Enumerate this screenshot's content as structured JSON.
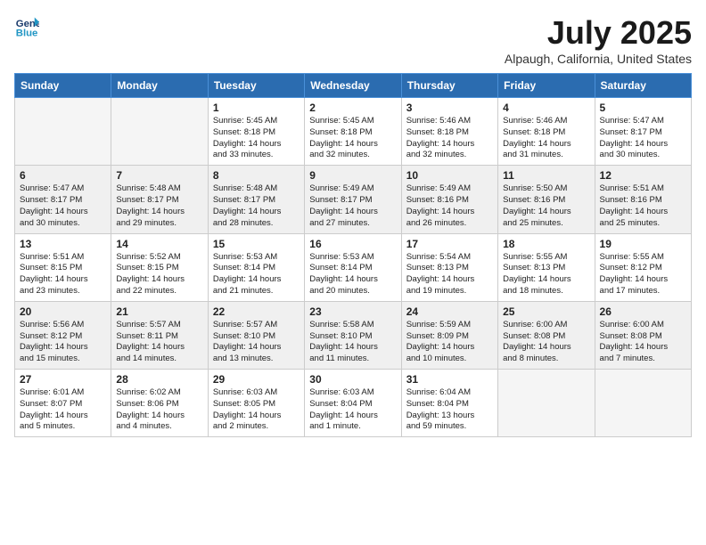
{
  "header": {
    "logo_line1": "General",
    "logo_line2": "Blue",
    "month": "July 2025",
    "location": "Alpaugh, California, United States"
  },
  "weekdays": [
    "Sunday",
    "Monday",
    "Tuesday",
    "Wednesday",
    "Thursday",
    "Friday",
    "Saturday"
  ],
  "weeks": [
    [
      {
        "day": "",
        "info": ""
      },
      {
        "day": "",
        "info": ""
      },
      {
        "day": "1",
        "info": "Sunrise: 5:45 AM\nSunset: 8:18 PM\nDaylight: 14 hours\nand 33 minutes."
      },
      {
        "day": "2",
        "info": "Sunrise: 5:45 AM\nSunset: 8:18 PM\nDaylight: 14 hours\nand 32 minutes."
      },
      {
        "day": "3",
        "info": "Sunrise: 5:46 AM\nSunset: 8:18 PM\nDaylight: 14 hours\nand 32 minutes."
      },
      {
        "day": "4",
        "info": "Sunrise: 5:46 AM\nSunset: 8:18 PM\nDaylight: 14 hours\nand 31 minutes."
      },
      {
        "day": "5",
        "info": "Sunrise: 5:47 AM\nSunset: 8:17 PM\nDaylight: 14 hours\nand 30 minutes."
      }
    ],
    [
      {
        "day": "6",
        "info": "Sunrise: 5:47 AM\nSunset: 8:17 PM\nDaylight: 14 hours\nand 30 minutes."
      },
      {
        "day": "7",
        "info": "Sunrise: 5:48 AM\nSunset: 8:17 PM\nDaylight: 14 hours\nand 29 minutes."
      },
      {
        "day": "8",
        "info": "Sunrise: 5:48 AM\nSunset: 8:17 PM\nDaylight: 14 hours\nand 28 minutes."
      },
      {
        "day": "9",
        "info": "Sunrise: 5:49 AM\nSunset: 8:17 PM\nDaylight: 14 hours\nand 27 minutes."
      },
      {
        "day": "10",
        "info": "Sunrise: 5:49 AM\nSunset: 8:16 PM\nDaylight: 14 hours\nand 26 minutes."
      },
      {
        "day": "11",
        "info": "Sunrise: 5:50 AM\nSunset: 8:16 PM\nDaylight: 14 hours\nand 25 minutes."
      },
      {
        "day": "12",
        "info": "Sunrise: 5:51 AM\nSunset: 8:16 PM\nDaylight: 14 hours\nand 25 minutes."
      }
    ],
    [
      {
        "day": "13",
        "info": "Sunrise: 5:51 AM\nSunset: 8:15 PM\nDaylight: 14 hours\nand 23 minutes."
      },
      {
        "day": "14",
        "info": "Sunrise: 5:52 AM\nSunset: 8:15 PM\nDaylight: 14 hours\nand 22 minutes."
      },
      {
        "day": "15",
        "info": "Sunrise: 5:53 AM\nSunset: 8:14 PM\nDaylight: 14 hours\nand 21 minutes."
      },
      {
        "day": "16",
        "info": "Sunrise: 5:53 AM\nSunset: 8:14 PM\nDaylight: 14 hours\nand 20 minutes."
      },
      {
        "day": "17",
        "info": "Sunrise: 5:54 AM\nSunset: 8:13 PM\nDaylight: 14 hours\nand 19 minutes."
      },
      {
        "day": "18",
        "info": "Sunrise: 5:55 AM\nSunset: 8:13 PM\nDaylight: 14 hours\nand 18 minutes."
      },
      {
        "day": "19",
        "info": "Sunrise: 5:55 AM\nSunset: 8:12 PM\nDaylight: 14 hours\nand 17 minutes."
      }
    ],
    [
      {
        "day": "20",
        "info": "Sunrise: 5:56 AM\nSunset: 8:12 PM\nDaylight: 14 hours\nand 15 minutes."
      },
      {
        "day": "21",
        "info": "Sunrise: 5:57 AM\nSunset: 8:11 PM\nDaylight: 14 hours\nand 14 minutes."
      },
      {
        "day": "22",
        "info": "Sunrise: 5:57 AM\nSunset: 8:10 PM\nDaylight: 14 hours\nand 13 minutes."
      },
      {
        "day": "23",
        "info": "Sunrise: 5:58 AM\nSunset: 8:10 PM\nDaylight: 14 hours\nand 11 minutes."
      },
      {
        "day": "24",
        "info": "Sunrise: 5:59 AM\nSunset: 8:09 PM\nDaylight: 14 hours\nand 10 minutes."
      },
      {
        "day": "25",
        "info": "Sunrise: 6:00 AM\nSunset: 8:08 PM\nDaylight: 14 hours\nand 8 minutes."
      },
      {
        "day": "26",
        "info": "Sunrise: 6:00 AM\nSunset: 8:08 PM\nDaylight: 14 hours\nand 7 minutes."
      }
    ],
    [
      {
        "day": "27",
        "info": "Sunrise: 6:01 AM\nSunset: 8:07 PM\nDaylight: 14 hours\nand 5 minutes."
      },
      {
        "day": "28",
        "info": "Sunrise: 6:02 AM\nSunset: 8:06 PM\nDaylight: 14 hours\nand 4 minutes."
      },
      {
        "day": "29",
        "info": "Sunrise: 6:03 AM\nSunset: 8:05 PM\nDaylight: 14 hours\nand 2 minutes."
      },
      {
        "day": "30",
        "info": "Sunrise: 6:03 AM\nSunset: 8:04 PM\nDaylight: 14 hours\nand 1 minute."
      },
      {
        "day": "31",
        "info": "Sunrise: 6:04 AM\nSunset: 8:04 PM\nDaylight: 13 hours\nand 59 minutes."
      },
      {
        "day": "",
        "info": ""
      },
      {
        "day": "",
        "info": ""
      }
    ]
  ]
}
